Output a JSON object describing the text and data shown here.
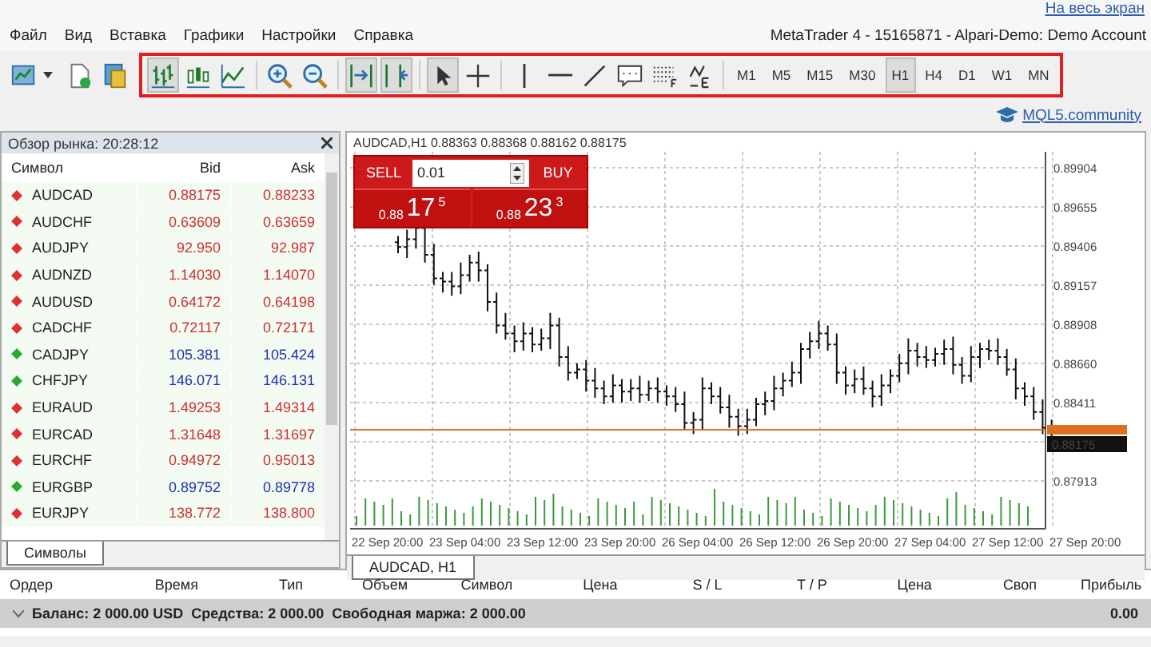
{
  "top_link": "На весь экран",
  "menu": [
    "Файл",
    "Вид",
    "Вставка",
    "Графики",
    "Настройки",
    "Справка"
  ],
  "window_title": "MetaTrader 4 - 15165871 - Alpari-Demo: Demo Account",
  "toolbar": {
    "left": [
      {
        "kind": "new-chart"
      },
      {
        "kind": "page"
      },
      {
        "kind": "money"
      }
    ],
    "tools": [
      {
        "kind": "bars",
        "selected": true
      },
      {
        "kind": "candles",
        "selected": false
      },
      {
        "kind": "line",
        "selected": false
      },
      {
        "kind": "sep"
      },
      {
        "kind": "zoom-in",
        "selected": false
      },
      {
        "kind": "zoom-out",
        "selected": false
      },
      {
        "kind": "sep"
      },
      {
        "kind": "autoscroll",
        "selected": true
      },
      {
        "kind": "shift",
        "selected": true
      },
      {
        "kind": "sep"
      },
      {
        "kind": "cursor",
        "selected": true
      },
      {
        "kind": "crosshair",
        "selected": false
      },
      {
        "kind": "sep"
      },
      {
        "kind": "vline",
        "selected": false
      },
      {
        "kind": "hline",
        "selected": false
      },
      {
        "kind": "trend",
        "selected": false
      },
      {
        "kind": "comment",
        "selected": false
      },
      {
        "kind": "fibo",
        "selected": false
      },
      {
        "kind": "shapes",
        "selected": false
      },
      {
        "kind": "sep"
      }
    ],
    "timeframes": [
      {
        "label": "M1",
        "selected": false
      },
      {
        "label": "M5",
        "selected": false
      },
      {
        "label": "M15",
        "selected": false
      },
      {
        "label": "M30",
        "selected": false
      },
      {
        "label": "H1",
        "selected": true
      },
      {
        "label": "H4",
        "selected": false
      },
      {
        "label": "D1",
        "selected": false
      },
      {
        "label": "W1",
        "selected": false
      },
      {
        "label": "MN",
        "selected": false
      }
    ]
  },
  "community_link": "MQL5.community",
  "market_watch": {
    "title": "Обзор рынка: 20:28:12",
    "columns": [
      "Символ",
      "Bid",
      "Ask"
    ],
    "rows": [
      {
        "symbol": "AUDCAD",
        "bid": "0.88175",
        "ask": "0.88233",
        "up": false
      },
      {
        "symbol": "AUDCHF",
        "bid": "0.63609",
        "ask": "0.63659",
        "up": false
      },
      {
        "symbol": "AUDJPY",
        "bid": "92.950",
        "ask": "92.987",
        "up": false
      },
      {
        "symbol": "AUDNZD",
        "bid": "1.14030",
        "ask": "1.14070",
        "up": false
      },
      {
        "symbol": "AUDUSD",
        "bid": "0.64172",
        "ask": "0.64198",
        "up": false
      },
      {
        "symbol": "CADCHF",
        "bid": "0.72117",
        "ask": "0.72171",
        "up": false
      },
      {
        "symbol": "CADJPY",
        "bid": "105.381",
        "ask": "105.424",
        "up": true
      },
      {
        "symbol": "CHFJPY",
        "bid": "146.071",
        "ask": "146.131",
        "up": true
      },
      {
        "symbol": "EURAUD",
        "bid": "1.49253",
        "ask": "1.49314",
        "up": false
      },
      {
        "symbol": "EURCAD",
        "bid": "1.31648",
        "ask": "1.31697",
        "up": false
      },
      {
        "symbol": "EURCHF",
        "bid": "0.94972",
        "ask": "0.95013",
        "up": false
      },
      {
        "symbol": "EURGBP",
        "bid": "0.89752",
        "ask": "0.89778",
        "up": true
      },
      {
        "symbol": "EURJPY",
        "bid": "138.772",
        "ask": "138.800",
        "up": false
      }
    ],
    "tab": "Символы"
  },
  "chart": {
    "header": "AUDCAD,H1  0.88363 0.88368 0.88162 0.88175",
    "trade": {
      "sell_label": "SELL",
      "buy_label": "BUY",
      "volume": "0.01",
      "sell_prefix": "0.88",
      "sell_big": "17",
      "sell_sup": "5",
      "buy_prefix": "0.88",
      "buy_big": "23",
      "buy_sup": "3"
    },
    "price_labels": [
      "0.89904",
      "0.89655",
      "0.89406",
      "0.89157",
      "0.88908",
      "0.88660",
      "0.88411",
      "0.87913"
    ],
    "bid_tag": "0.88175",
    "time_labels": [
      "22 Sep 20:00",
      "23 Sep 04:00",
      "23 Sep 12:00",
      "23 Sep 20:00",
      "26 Sep 04:00",
      "26 Sep 12:00",
      "26 Sep 20:00",
      "27 Sep 04:00",
      "27 Sep 12:00",
      "27 Sep 20:00"
    ],
    "tab": "AUDCAD, H1"
  },
  "terminal": {
    "columns": [
      "Ордер",
      "Время",
      "Тип",
      "Объем",
      "Символ",
      "Цена",
      "S / L",
      "T / P",
      "Цена",
      "Своп",
      "Прибыль"
    ],
    "balance": [
      "Баланс: 2 000.00 USD",
      "Средства: 2 000.00",
      "Свободная маржа: 2 000.00"
    ],
    "profit": "0.00"
  }
}
